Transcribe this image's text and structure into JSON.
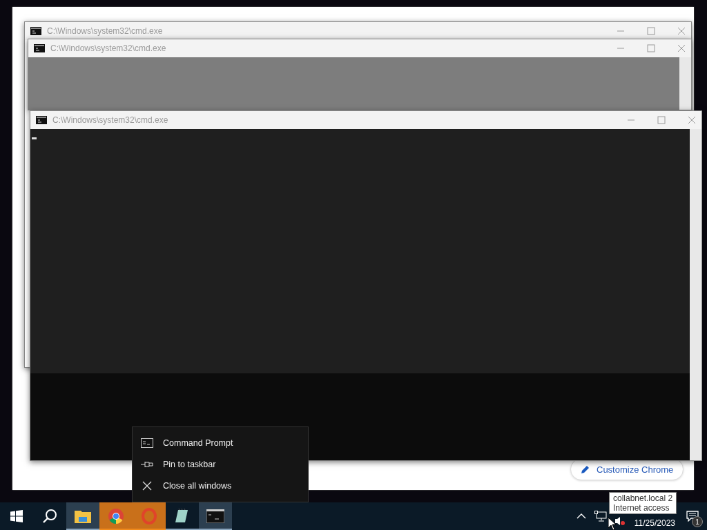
{
  "browser": {
    "button": "Customize Chrome"
  },
  "windows": [
    {
      "title": "C:\\Windows\\system32\\cmd.exe",
      "kind": "blank"
    },
    {
      "title": "C:\\Windows\\system32\\cmd.exe",
      "kind": "grey"
    },
    {
      "title": "C:\\Windows\\system32\\cmd.exe",
      "kind": "console"
    }
  ],
  "context_menu": {
    "items": [
      {
        "kind": "app",
        "label": "Command Prompt"
      },
      {
        "kind": "pin",
        "label": "Pin to taskbar"
      },
      {
        "kind": "close",
        "label": "Close all windows"
      }
    ]
  },
  "taskbar": {
    "apps": [
      {
        "kind": "explorer",
        "highlighted": true,
        "flashing": false
      },
      {
        "kind": "chrome",
        "highlighted": false,
        "flashing": true
      },
      {
        "kind": "opera",
        "highlighted": false,
        "flashing": true
      },
      {
        "kind": "notepad",
        "highlighted": false,
        "flashing": false
      },
      {
        "kind": "cmd",
        "highlighted": true,
        "flashing": false
      }
    ],
    "tray": {
      "date": "11/25/2023",
      "notification_count": "1"
    },
    "tooltip": [
      "collabnet.local 2",
      "Internet access"
    ]
  }
}
